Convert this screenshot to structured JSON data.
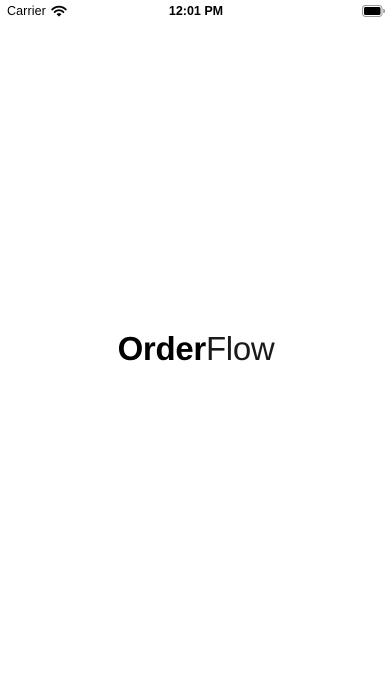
{
  "status_bar": {
    "carrier": "Carrier",
    "time": "12:01 PM",
    "icons": [
      "wifi-icon",
      "battery-icon"
    ]
  },
  "splash": {
    "logo_bold": "Order",
    "logo_light": "Flow"
  },
  "colors": {
    "background": "#ffffff",
    "text": "#000000"
  }
}
